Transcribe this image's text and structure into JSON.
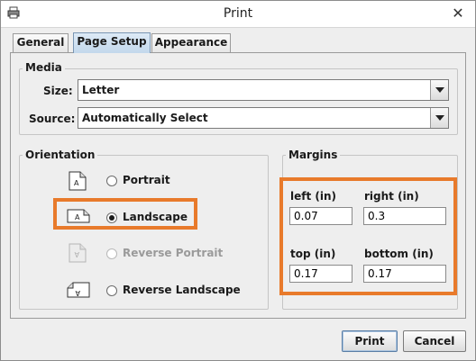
{
  "window": {
    "title": "Print"
  },
  "tabs": [
    {
      "label": "General",
      "active": false
    },
    {
      "label": "Page Setup",
      "active": true
    },
    {
      "label": "Appearance",
      "active": false
    }
  ],
  "media": {
    "group_title": "Media",
    "size_label": "Size:",
    "size_value": "Letter",
    "source_label": "Source:",
    "source_value": "Automatically Select"
  },
  "orientation": {
    "group_title": "Orientation",
    "options": [
      {
        "label": "Portrait",
        "checked": false,
        "enabled": true,
        "icon": "portrait-page-icon"
      },
      {
        "label": "Landscape",
        "checked": true,
        "enabled": true,
        "icon": "landscape-page-icon"
      },
      {
        "label": "Reverse Portrait",
        "checked": false,
        "enabled": false,
        "icon": "reverse-portrait-page-icon"
      },
      {
        "label": "Reverse Landscape",
        "checked": false,
        "enabled": true,
        "icon": "reverse-landscape-page-icon"
      }
    ]
  },
  "margins": {
    "group_title": "Margins",
    "left_label": "left (in)",
    "left_value": "0.07",
    "right_label": "right (in)",
    "right_value": "0.3",
    "top_label": "top (in)",
    "top_value": "0.17",
    "bottom_label": "bottom (in)",
    "bottom_value": "0.17"
  },
  "buttons": {
    "print": "Print",
    "cancel": "Cancel"
  },
  "colors": {
    "highlight": "#e87a2b",
    "active_tab": "#c3d8ec"
  }
}
